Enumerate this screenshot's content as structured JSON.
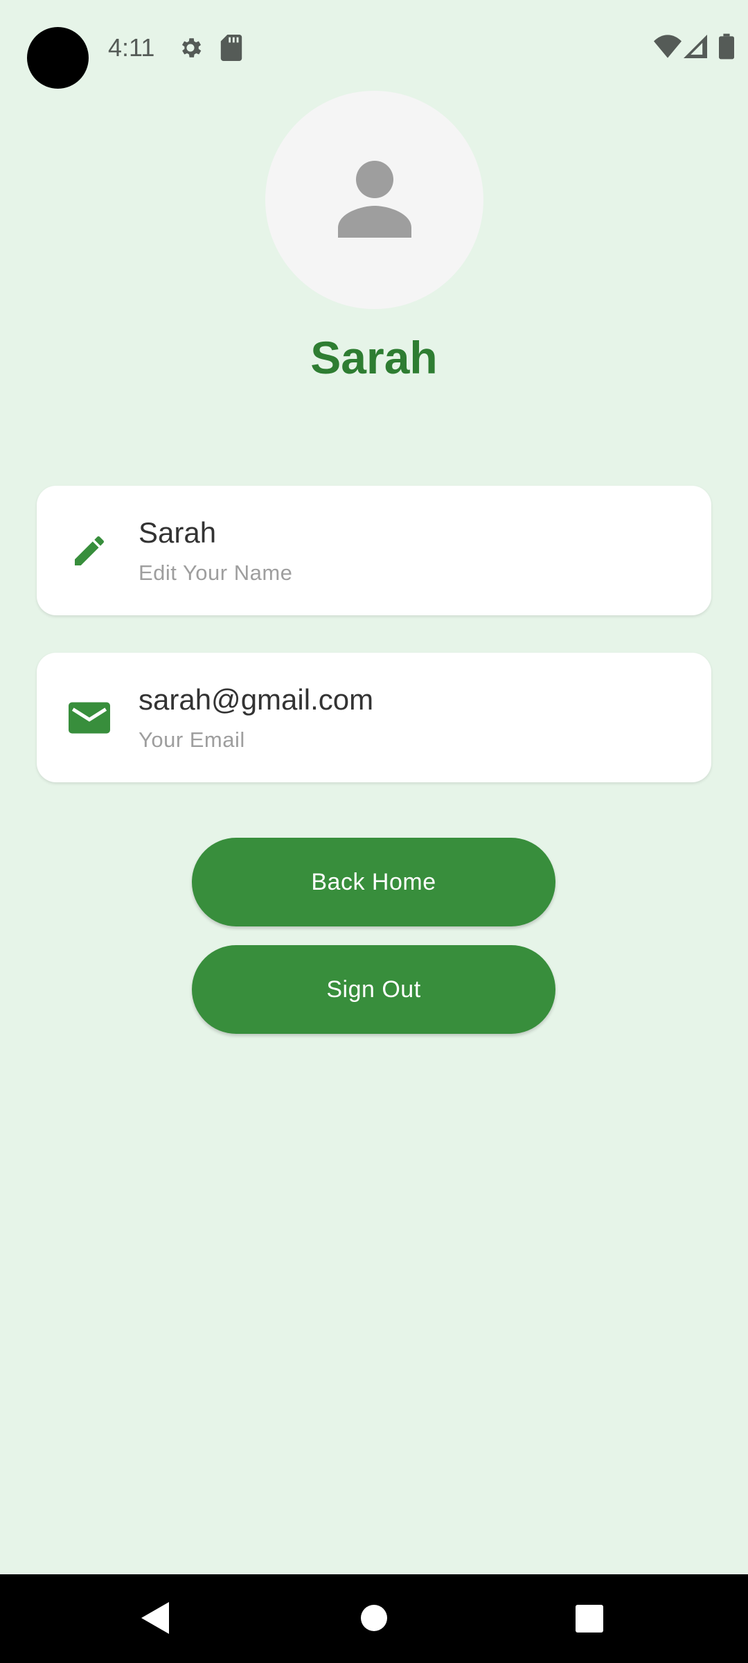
{
  "status_bar": {
    "time": "4:11"
  },
  "profile": {
    "display_name": "Sarah"
  },
  "cards": {
    "name": {
      "value": "Sarah",
      "label": "Edit Your Name",
      "icon": "pencil-icon"
    },
    "email": {
      "value": "sarah@gmail.com",
      "label": "Your Email",
      "icon": "mail-icon"
    }
  },
  "buttons": {
    "back_home": "Back Home",
    "sign_out": "Sign Out"
  },
  "colors": {
    "background": "#e6f4e8",
    "accent": "#2e7d32",
    "button": "#388e3c"
  }
}
